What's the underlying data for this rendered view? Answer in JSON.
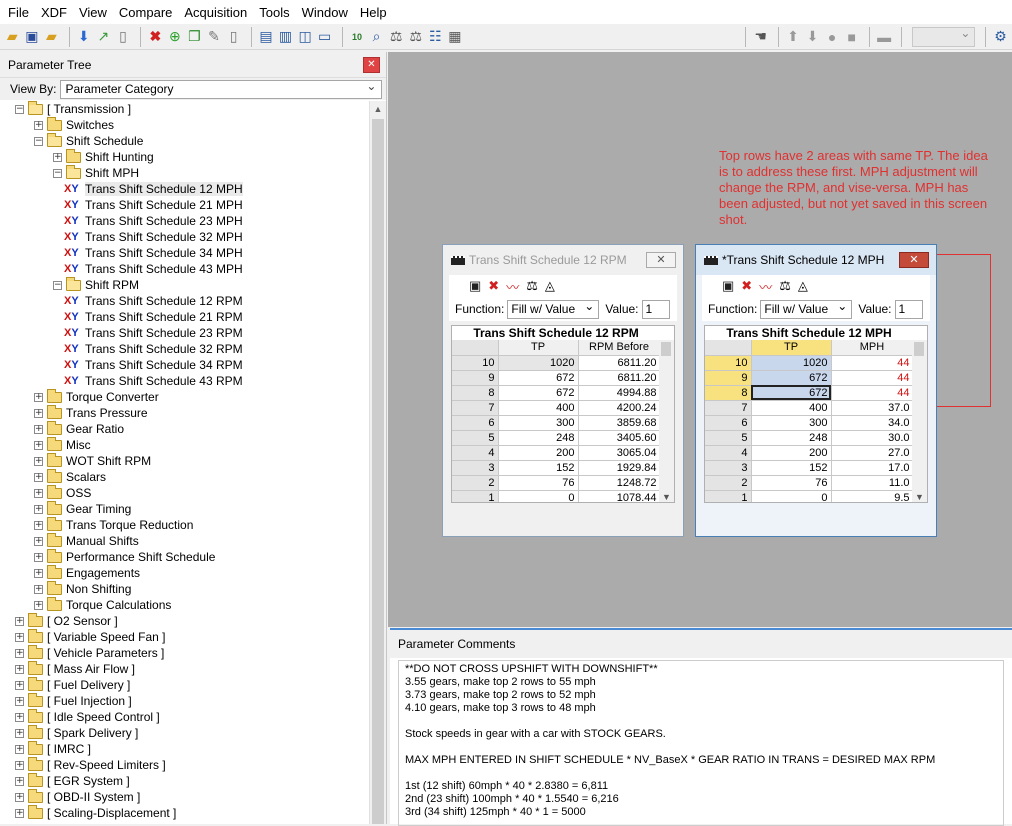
{
  "menu": [
    "File",
    "XDF",
    "View",
    "Compare",
    "Acquisition",
    "Tools",
    "Window",
    "Help"
  ],
  "tree_panel": {
    "title": "Parameter Tree",
    "view_by_label": "View By:",
    "view_by_value": "Parameter Category",
    "items": [
      {
        "label": "[ Transmission ]",
        "type": "folder-open",
        "expander": "−"
      },
      {
        "label": "Switches",
        "type": "folder",
        "expander": "+"
      },
      {
        "label": "Shift Schedule",
        "type": "folder-open",
        "expander": "−"
      },
      {
        "label": "Shift Hunting",
        "type": "folder",
        "expander": "+"
      },
      {
        "label": "Shift MPH",
        "type": "folder-open",
        "expander": "−"
      },
      {
        "label": "Trans Shift Schedule 12 MPH",
        "type": "table",
        "selected": true
      },
      {
        "label": "Trans Shift Schedule 21 MPH",
        "type": "table"
      },
      {
        "label": "Trans Shift Schedule 23 MPH",
        "type": "table"
      },
      {
        "label": "Trans Shift Schedule 32 MPH",
        "type": "table"
      },
      {
        "label": "Trans Shift Schedule 34 MPH",
        "type": "table"
      },
      {
        "label": "Trans Shift Schedule 43 MPH",
        "type": "table"
      },
      {
        "label": "Shift RPM",
        "type": "folder-open",
        "expander": "−"
      },
      {
        "label": "Trans Shift Schedule 12 RPM",
        "type": "table"
      },
      {
        "label": "Trans Shift Schedule 21 RPM",
        "type": "table"
      },
      {
        "label": "Trans Shift Schedule 23 RPM",
        "type": "table"
      },
      {
        "label": "Trans Shift Schedule 32 RPM",
        "type": "table"
      },
      {
        "label": "Trans Shift Schedule 34 RPM",
        "type": "table"
      },
      {
        "label": "Trans Shift Schedule 43 RPM",
        "type": "table"
      },
      {
        "label": "Torque Converter",
        "type": "folder",
        "expander": "+"
      },
      {
        "label": "Trans Pressure",
        "type": "folder",
        "expander": "+"
      },
      {
        "label": "Gear Ratio",
        "type": "folder",
        "expander": "+"
      },
      {
        "label": "Misc",
        "type": "folder",
        "expander": "+"
      },
      {
        "label": "WOT Shift RPM",
        "type": "folder",
        "expander": "+"
      },
      {
        "label": "Scalars",
        "type": "folder",
        "expander": "+"
      },
      {
        "label": "OSS",
        "type": "folder",
        "expander": "+"
      },
      {
        "label": "Gear Timing",
        "type": "folder",
        "expander": "+"
      },
      {
        "label": "Trans Torque Reduction",
        "type": "folder",
        "expander": "+"
      },
      {
        "label": "Manual Shifts",
        "type": "folder",
        "expander": "+"
      },
      {
        "label": "Performance Shift Schedule",
        "type": "folder",
        "expander": "+"
      },
      {
        "label": "Engagements",
        "type": "folder",
        "expander": "+"
      },
      {
        "label": "Non Shifting",
        "type": "folder",
        "expander": "+"
      },
      {
        "label": "Torque Calculations",
        "type": "folder",
        "expander": "+"
      },
      {
        "label": "[ O2 Sensor ]",
        "type": "folder",
        "expander": "+"
      },
      {
        "label": "[ Variable Speed Fan ]",
        "type": "folder",
        "expander": "+"
      },
      {
        "label": "[ Vehicle Parameters ]",
        "type": "folder",
        "expander": "+"
      },
      {
        "label": "[ Mass Air Flow ]",
        "type": "folder",
        "expander": "+"
      },
      {
        "label": "[ Fuel Delivery ]",
        "type": "folder",
        "expander": "+"
      },
      {
        "label": "[ Fuel Injection ]",
        "type": "folder",
        "expander": "+"
      },
      {
        "label": "[ Idle Speed Control ]",
        "type": "folder",
        "expander": "+"
      },
      {
        "label": "[ Spark Delivery ]",
        "type": "folder",
        "expander": "+"
      },
      {
        "label": "[ IMRC ]",
        "type": "folder",
        "expander": "+"
      },
      {
        "label": "[ Rev-Speed Limiters ]",
        "type": "folder",
        "expander": "+"
      },
      {
        "label": "[ EGR System ]",
        "type": "folder",
        "expander": "+"
      },
      {
        "label": "[ OBD-II System ]",
        "type": "folder",
        "expander": "+"
      },
      {
        "label": "[ Scaling-Displacement ]",
        "type": "folder",
        "expander": "+"
      }
    ]
  },
  "annotation": "Top rows have 2 areas with same TP. The idea is to address these first. MPH adjustment will change the RPM, and vise-versa. MPH has been adjusted, but not yet saved in this screen shot.",
  "rpm_window": {
    "title": "Trans Shift Schedule 12 RPM",
    "function_label": "Function:",
    "function_value": "Fill w/ Value",
    "value_label": "Value:",
    "value": "1",
    "table_title": "Trans Shift Schedule 12 RPM",
    "col1": "TP",
    "col2": "RPM Before",
    "rows": [
      {
        "idx": "10",
        "tp": "1020",
        "val": "6811.20"
      },
      {
        "idx": "9",
        "tp": "672",
        "val": "6811.20"
      },
      {
        "idx": "8",
        "tp": "672",
        "val": "4994.88"
      },
      {
        "idx": "7",
        "tp": "400",
        "val": "4200.24"
      },
      {
        "idx": "6",
        "tp": "300",
        "val": "3859.68"
      },
      {
        "idx": "5",
        "tp": "248",
        "val": "3405.60"
      },
      {
        "idx": "4",
        "tp": "200",
        "val": "3065.04"
      },
      {
        "idx": "3",
        "tp": "152",
        "val": "1929.84"
      },
      {
        "idx": "2",
        "tp": "76",
        "val": "1248.72"
      },
      {
        "idx": "1",
        "tp": "0",
        "val": "1078.44"
      }
    ]
  },
  "mph_window": {
    "title": "*Trans Shift Schedule 12 MPH",
    "function_label": "Function:",
    "function_value": "Fill w/ Value",
    "value_label": "Value:",
    "value": "1",
    "table_title": "Trans Shift Schedule 12 MPH",
    "col1": "TP",
    "col2": "MPH",
    "rows": [
      {
        "idx": "10",
        "tp": "1020",
        "val": "44"
      },
      {
        "idx": "9",
        "tp": "672",
        "val": "44"
      },
      {
        "idx": "8",
        "tp": "672",
        "val": "44"
      },
      {
        "idx": "7",
        "tp": "400",
        "val": "37.0"
      },
      {
        "idx": "6",
        "tp": "300",
        "val": "34.0"
      },
      {
        "idx": "5",
        "tp": "248",
        "val": "30.0"
      },
      {
        "idx": "4",
        "tp": "200",
        "val": "27.0"
      },
      {
        "idx": "3",
        "tp": "152",
        "val": "17.0"
      },
      {
        "idx": "2",
        "tp": "76",
        "val": "11.0"
      },
      {
        "idx": "1",
        "tp": "0",
        "val": "9.5"
      }
    ]
  },
  "comments": {
    "title": "Parameter Comments",
    "lines": [
      "**DO NOT CROSS UPSHIFT WITH DOWNSHIFT**",
      "3.55 gears, make top 2 rows to 55 mph",
      "3.73 gears, make top 2 rows to 52 mph",
      "4.10 gears, make top 3 rows to 48 mph",
      "",
      "Stock speeds in gear with a car with STOCK GEARS.",
      "",
      "MAX MPH ENTERED IN SHIFT SCHEDULE * NV_BaseX * GEAR RATIO IN TRANS = DESIRED MAX RPM",
      "",
      "1st (12 shift) 60mph * 40 * 2.8380 = 6,811",
      "2nd (23 shift) 100mph * 40 * 1.5540 = 6,216",
      "3rd (34 shift) 125mph * 40 * 1 = 5000"
    ]
  }
}
